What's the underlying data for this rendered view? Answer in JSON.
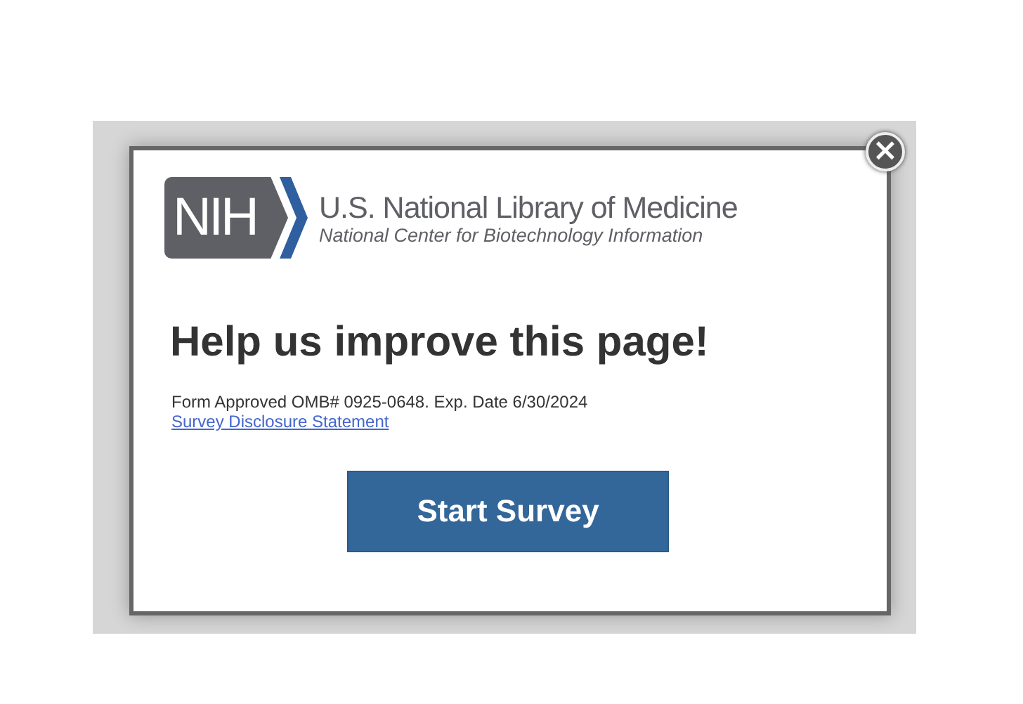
{
  "close_button": {
    "label": "×"
  },
  "logo": {
    "badge": "NIH",
    "title": "U.S. National Library of Medicine",
    "subtitle": "National Center for Biotechnology Information"
  },
  "heading": "Help us improve this page!",
  "form_note": "Form Approved OMB# 0925-0648. Exp. Date 6/30/2024",
  "disclosure_link": "Survey Disclosure Statement",
  "start_button": "Start Survey"
}
